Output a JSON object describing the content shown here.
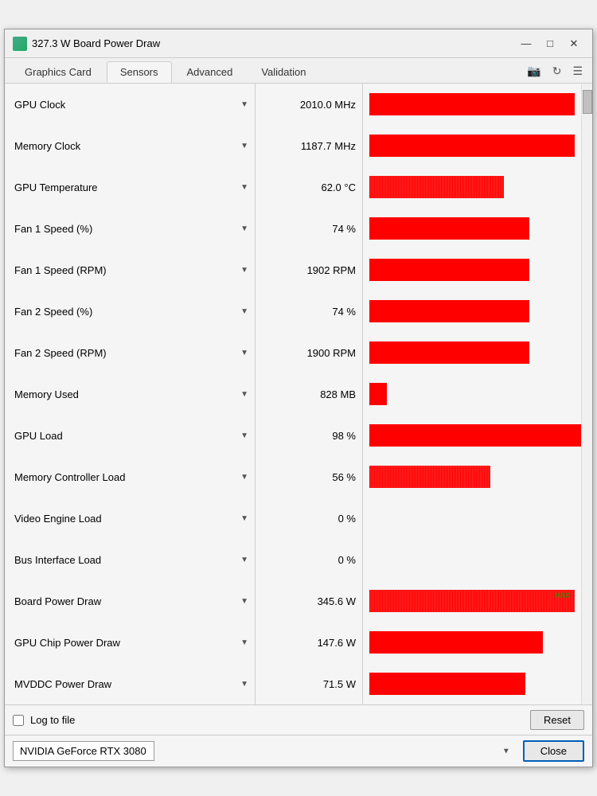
{
  "window": {
    "title": "327.3 W Board Power Draw",
    "icon": "gpu-icon"
  },
  "titlebar": {
    "minimize_label": "—",
    "maximize_label": "□",
    "close_label": "✕"
  },
  "tabs": [
    {
      "id": "graphics-card",
      "label": "Graphics Card",
      "active": false
    },
    {
      "id": "sensors",
      "label": "Sensors",
      "active": true
    },
    {
      "id": "advanced",
      "label": "Advanced",
      "active": false
    },
    {
      "id": "validation",
      "label": "Validation",
      "active": false
    }
  ],
  "sensors": [
    {
      "name": "GPU Clock",
      "value": "2010.0 MHz",
      "bar_pct": 95,
      "noise": false
    },
    {
      "name": "Memory Clock",
      "value": "1187.7 MHz",
      "bar_pct": 95,
      "noise": false
    },
    {
      "name": "GPU Temperature",
      "value": "62.0 °C",
      "bar_pct": 62,
      "noise": true
    },
    {
      "name": "Fan 1 Speed (%)",
      "value": "74 %",
      "bar_pct": 74,
      "noise": false
    },
    {
      "name": "Fan 1 Speed (RPM)",
      "value": "1902 RPM",
      "bar_pct": 74,
      "noise": false
    },
    {
      "name": "Fan 2 Speed (%)",
      "value": "74 %",
      "bar_pct": 74,
      "noise": false
    },
    {
      "name": "Fan 2 Speed (RPM)",
      "value": "1900 RPM",
      "bar_pct": 74,
      "noise": false
    },
    {
      "name": "Memory Used",
      "value": "828 MB",
      "bar_pct": 8,
      "noise": false
    },
    {
      "name": "GPU Load",
      "value": "98 %",
      "bar_pct": 98,
      "noise": false
    },
    {
      "name": "Memory Controller Load",
      "value": "56 %",
      "bar_pct": 56,
      "noise": true
    },
    {
      "name": "Video Engine Load",
      "value": "0 %",
      "bar_pct": 0,
      "noise": false
    },
    {
      "name": "Bus Interface Load",
      "value": "0 %",
      "bar_pct": 0,
      "noise": false
    },
    {
      "name": "Board Power Draw",
      "value": "345.6 W",
      "bar_pct": 95,
      "noise": true,
      "max_marker": true
    },
    {
      "name": "GPU Chip Power Draw",
      "value": "147.6 W",
      "bar_pct": 80,
      "noise": false
    },
    {
      "name": "MVDDC Power Draw",
      "value": "71.5 W",
      "bar_pct": 72,
      "noise": false
    }
  ],
  "bottom": {
    "log_label": "Log to file",
    "reset_label": "Reset"
  },
  "footer": {
    "gpu_name": "NVIDIA GeForce RTX 3080",
    "close_label": "Close"
  },
  "colors": {
    "bar_red": "#ff0000",
    "accent_blue": "#005fb8"
  }
}
